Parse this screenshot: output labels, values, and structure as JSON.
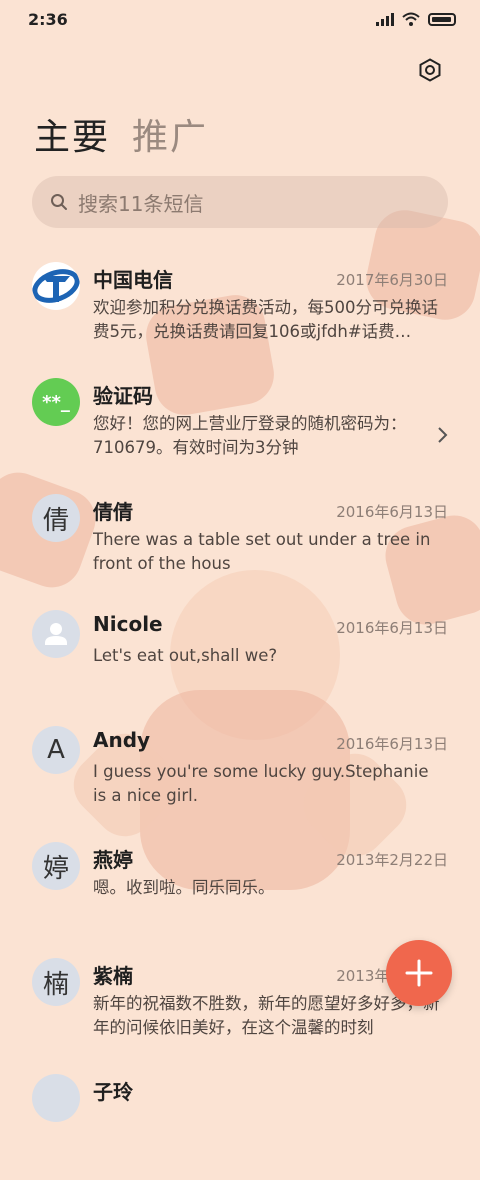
{
  "status_bar": {
    "time": "2:36"
  },
  "header": {
    "tabs": [
      {
        "label": "主要"
      },
      {
        "label": "推广"
      }
    ],
    "settings_icon": "gear-icon"
  },
  "search": {
    "placeholder": "搜索11条短信"
  },
  "conversations": [
    {
      "name": "中国电信",
      "date": "2017年6月30日",
      "preview": "欢迎参加积分兑换话费活动，每500分可兑换话费5元，兑换话费请回复106或jfdh#话费…",
      "avatar": ""
    },
    {
      "name": "验证码",
      "date": "",
      "preview": "您好！您的网上营业厅登录的随机密码为：710679。有效时间为3分钟",
      "avatar": "**_"
    },
    {
      "name": "倩倩",
      "date": "2016年6月13日",
      "preview": "There was a table set out under a tree in front of the hous",
      "avatar": "倩"
    },
    {
      "name": "Nicole",
      "date": "2016年6月13日",
      "preview": "Let's eat out,shall we?",
      "avatar": ""
    },
    {
      "name": "Andy",
      "date": "2016年6月13日",
      "preview": "I guess you're some lucky guy.Stephanie is a nice girl.",
      "avatar": "A"
    },
    {
      "name": "燕婷",
      "date": "2013年2月22日",
      "preview": "嗯。收到啦。同乐同乐。",
      "avatar": "婷"
    },
    {
      "name": "紫楠",
      "date": "2013年2月22日",
      "preview": "新年的祝福数不胜数，新年的愿望好多好多，新年的问候依旧美好，在这个温馨的时刻",
      "avatar": "楠"
    },
    {
      "name": "子玲",
      "date": "",
      "preview": "",
      "avatar": ""
    }
  ],
  "colors": {
    "accent": "#f0674d",
    "background": "#fbe3d3",
    "verify_avatar": "#63cc53"
  }
}
